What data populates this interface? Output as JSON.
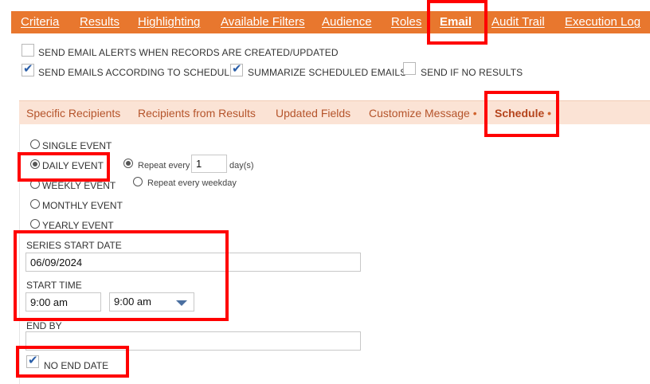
{
  "top_tabs": {
    "criteria": "Criteria",
    "results": "Results",
    "highlighting": "Highlighting",
    "available_filters": "Available Filters",
    "audience": "Audience",
    "roles": "Roles",
    "email": "Email",
    "audit_trail": "Audit Trail",
    "execution_log": "Execution Log"
  },
  "options": {
    "send_alerts": {
      "label": "SEND EMAIL ALERTS WHEN RECORDS ARE CREATED/UPDATED",
      "checked": false
    },
    "send_schedule": {
      "label": "SEND EMAILS ACCORDING TO SCHEDULE",
      "checked": true
    },
    "summarize": {
      "label": "SUMMARIZE SCHEDULED EMAILS",
      "checked": true
    },
    "send_no_results": {
      "label": "SEND IF NO RESULTS",
      "checked": false
    }
  },
  "sub_tabs": {
    "specific_recipients": "Specific Recipients",
    "recipients_from_results": "Recipients from Results",
    "updated_fields": "Updated Fields",
    "customize_message": "Customize Message",
    "schedule": "Schedule",
    "dot": "•"
  },
  "schedule": {
    "event_types": {
      "single": "SINGLE EVENT",
      "daily": "DAILY EVENT",
      "weekly": "WEEKLY EVENT",
      "monthly": "MONTHLY EVENT",
      "yearly": "YEARLY EVENT"
    },
    "selected_event": "DAILY EVENT",
    "repeat_every_label": "Repeat every",
    "repeat_every_value": "1",
    "repeat_unit": "day(s)",
    "repeat_every_weekday": "Repeat every weekday",
    "series_start_date_label": "SERIES START DATE",
    "series_start_date": "06/09/2024",
    "start_time_label": "START TIME",
    "start_time_text": "9:00 am",
    "start_time_select": "9:00 am",
    "end_by_label": "END BY",
    "end_by_value": "",
    "no_end_date_label": "NO END DATE",
    "no_end_date_checked": true
  },
  "colors": {
    "top_bar": "#e8772e",
    "sub_bar": "#fbe3d5",
    "sub_tab_text": "#b5542b",
    "annotation": "#ff0000",
    "checkmark": "#2a5ea8"
  },
  "icons": {
    "check": "✔",
    "dropdown": "chevron-down-icon"
  }
}
